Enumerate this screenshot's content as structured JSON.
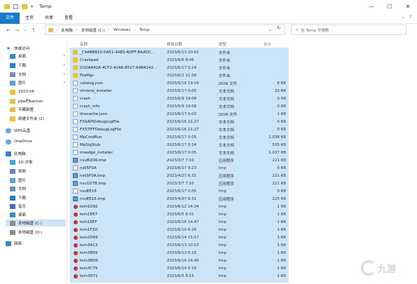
{
  "window": {
    "title": "Temp",
    "controls": [
      "—",
      "☐",
      "✕"
    ]
  },
  "ribbon": {
    "tabs": [
      "文件",
      "主页",
      "共享",
      "查看"
    ],
    "active_tab": "文件"
  },
  "address": {
    "segments": [
      "此电脑",
      "本地磁盘 (C:)",
      "Windows",
      "Temp"
    ],
    "search_placeholder": "在 Temp 中搜索"
  },
  "sidebar": {
    "quick_access": "快速访问",
    "items": [
      {
        "label": "桌面",
        "icon": "desktop-icon",
        "pinned": true
      },
      {
        "label": "下载",
        "icon": "download-icon",
        "pinned": true
      },
      {
        "label": "文档",
        "icon": "documents-icon",
        "pinned": true
      },
      {
        "label": "图片",
        "icon": "pictures-icon",
        "pinned": true
      },
      {
        "label": "2023-06",
        "icon": "folder-icon"
      },
      {
        "label": "pbe的banner",
        "icon": "folder-icon"
      },
      {
        "label": "不藏新整",
        "icon": "folder-icon"
      },
      {
        "label": "新建文件夹 (2)",
        "icon": "folder-icon"
      }
    ],
    "wps": "WPS云盘",
    "onedrive": "OneDrive",
    "this_pc": "此电脑",
    "pc_items": [
      {
        "label": "3D 对象",
        "icon": "3d-objects-icon"
      },
      {
        "label": "视频",
        "icon": "video-icon"
      },
      {
        "label": "图片",
        "icon": "pictures-icon"
      },
      {
        "label": "文档",
        "icon": "documents-icon"
      },
      {
        "label": "下载",
        "icon": "download-icon"
      },
      {
        "label": "音乐",
        "icon": "music-icon"
      },
      {
        "label": "桌面",
        "icon": "desktop-icon"
      },
      {
        "label": "本地磁盘 (C:)",
        "icon": "drive-icon"
      },
      {
        "label": "本地磁盘 (D:)",
        "icon": "drive-icon"
      }
    ],
    "network": "网络"
  },
  "columns": {
    "name": "名称",
    "date": "修改日期",
    "type": "类型",
    "size": "大小"
  },
  "files": [
    {
      "name": "_C9ABB810-5A51-4AE0-ADFF-BAADC...",
      "date": "2023/6/13 20:01",
      "type": "文件夹",
      "size": "",
      "kind": "folder"
    },
    {
      "name": "Crashpad",
      "date": "2023/6/6 8:06",
      "type": "文件夹",
      "size": "",
      "kind": "folder"
    },
    {
      "name": "D1DA642A-4CF2-41A6-8527-64B4142...",
      "date": "2023/6/17 0:14",
      "type": "文件夹",
      "size": "",
      "kind": "folder"
    },
    {
      "name": "FileMgr",
      "date": "2023/6/2 11:58",
      "type": "文件夹",
      "size": "",
      "kind": "folder"
    },
    {
      "name": "catalog.json",
      "date": "2023/6/16 19:16",
      "type": "JSON 文件",
      "size": "8 KB",
      "kind": "file"
    },
    {
      "name": "chrome_installer",
      "date": "2023/6/17 0:05",
      "type": "文本文档",
      "size": "33 KB",
      "kind": "file"
    },
    {
      "name": "crash",
      "date": "2023/6/9 19:08",
      "type": "文本文档",
      "size": "0 KB",
      "kind": "file"
    },
    {
      "name": "crash_info",
      "date": "2023/6/9 19:06",
      "type": "文本文档",
      "size": "0 KB",
      "kind": "file"
    },
    {
      "name": "dnscache.json",
      "date": "2023/6/17 0:03",
      "type": "JSON 文件",
      "size": "1 KB",
      "kind": "file"
    },
    {
      "name": "FXSAPIDebugLogFile",
      "date": "2023/6/16 21:27",
      "type": "文本文档",
      "size": "0 KB",
      "kind": "file"
    },
    {
      "name": "FXSTIFFDebugLogFile",
      "date": "2023/6/16 21:27",
      "type": "文本文档",
      "size": "0 KB",
      "kind": "file"
    },
    {
      "name": "MpCmdRun",
      "date": "2023/6/17 0:05",
      "type": "文本文档",
      "size": "1,038 KB",
      "kind": "file"
    },
    {
      "name": "MpSigStub",
      "date": "2023/6/17 0:14",
      "type": "文本文档",
      "size": "535 KB",
      "kind": "file"
    },
    {
      "name": "msedge_installer",
      "date": "2023/6/17 0:05",
      "type": "文本文档",
      "size": "1,037 KB",
      "kind": "file"
    },
    {
      "name": "nsuB2DA.tmp",
      "date": "2023/3/7 7:10",
      "type": "应用程序",
      "size": "221 KB",
      "kind": "app"
    },
    {
      "name": "nsk5F0A",
      "date": "2023/6/17 9:23",
      "type": "tmp",
      "size": "0 KB",
      "kind": "tmp"
    },
    {
      "name": "nsk5F0A.tmp",
      "date": "2023/4/27 6:31",
      "type": "应用程序",
      "size": "221 KB",
      "kind": "app"
    },
    {
      "name": "nsu1D78.tmp",
      "date": "2023/3/7 7:10",
      "type": "应用程序",
      "size": "221 KB",
      "kind": "app"
    },
    {
      "name": "nsuEE16",
      "date": "2023/6/17 0:05",
      "type": "tmp",
      "size": "0 KB",
      "kind": "tmp"
    },
    {
      "name": "nsuEE16.tmp",
      "date": "2023/4/27 6:31",
      "type": "应用程序",
      "size": "225 KB",
      "kind": "app"
    },
    {
      "name": "tem1D92",
      "date": "2023/6/12 14:34",
      "type": "tmp",
      "size": "1 KB",
      "kind": "dot"
    },
    {
      "name": "tem1E67",
      "date": "2023/6/5 8:31",
      "type": "tmp",
      "size": "1 KB",
      "kind": "dot"
    },
    {
      "name": "tem1EEF",
      "date": "2023/6/16 14:47",
      "type": "tmp",
      "size": "1 KB",
      "kind": "dot"
    },
    {
      "name": "tem1F1D",
      "date": "2023/6/10 6:16",
      "type": "tmp",
      "size": "1 KB",
      "kind": "dot"
    },
    {
      "name": "tem2D69",
      "date": "2023/6/14 15:17",
      "type": "tmp",
      "size": "1 KB",
      "kind": "dot"
    },
    {
      "name": "tem3A13",
      "date": "2023/6/13 10:13",
      "type": "tmp",
      "size": "1 KB",
      "kind": "dot"
    },
    {
      "name": "tem3B99",
      "date": "2023/6/13 6:15",
      "type": "tmp",
      "size": "1 KB",
      "kind": "dot"
    },
    {
      "name": "tem3BD6",
      "date": "2023/6/16 14:48",
      "type": "tmp",
      "size": "1 KB",
      "kind": "dot"
    },
    {
      "name": "tem3C79",
      "date": "2023/6/14 6:15",
      "type": "tmp",
      "size": "1 KB",
      "kind": "dot"
    },
    {
      "name": "tem3D71",
      "date": "2023/6/5 8:15",
      "type": "tmp",
      "size": "1 KB",
      "kind": "dot"
    }
  ],
  "watermark": {
    "text": "九游"
  }
}
